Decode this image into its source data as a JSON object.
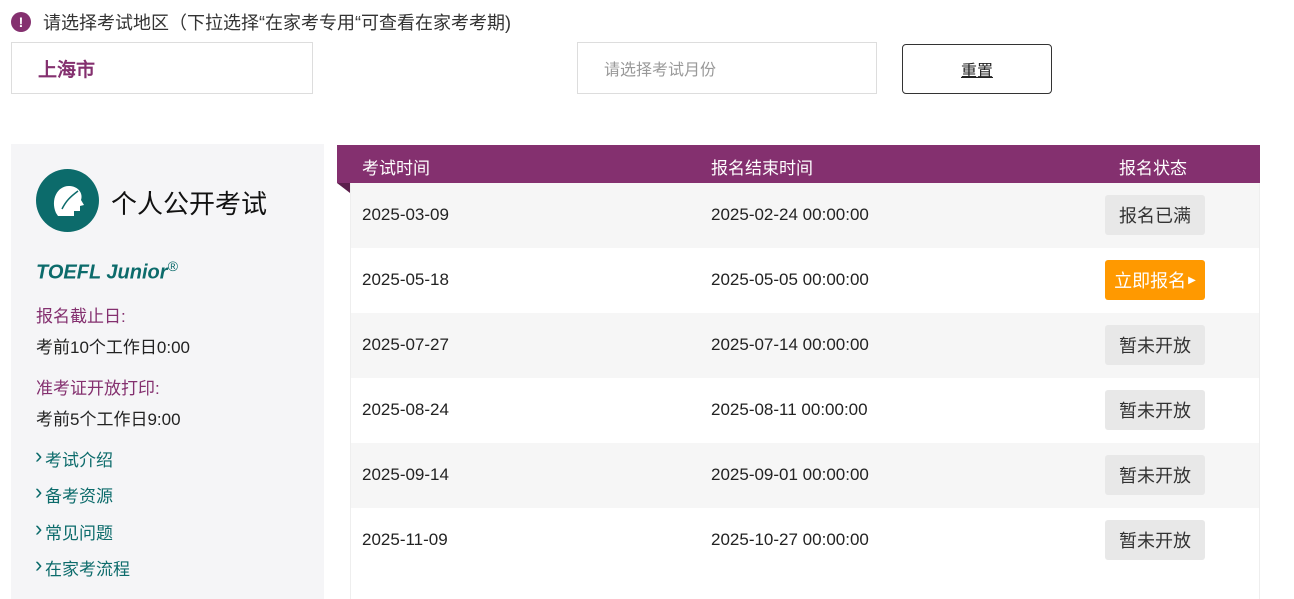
{
  "notice": "请选择考试地区（下拉选择“在家考专用“可查看在家考考期)",
  "filters": {
    "region": "上海市",
    "month_placeholder": "请选择考试月份",
    "reset": "重置"
  },
  "panel": {
    "title": "个人公开考试",
    "brand": "TOEFL Junior",
    "brand_mark": "®",
    "deadline_label": "报名截止日:",
    "deadline_value": "考前10个工作日0:00",
    "admit_label": "准考证开放打印:",
    "admit_value": "考前5个工作日9:00",
    "links": [
      "考试介绍",
      "备考资源",
      "常见问题",
      "在家考流程"
    ]
  },
  "table": {
    "headers": [
      "考试时间",
      "报名结束时间",
      "报名状态"
    ],
    "rows": [
      {
        "date": "2025-03-09",
        "end": "2025-02-24 00:00:00",
        "status": "报名已满",
        "open": false
      },
      {
        "date": "2025-05-18",
        "end": "2025-05-05 00:00:00",
        "status": "立即报名",
        "open": true
      },
      {
        "date": "2025-07-27",
        "end": "2025-07-14 00:00:00",
        "status": "暂未开放",
        "open": false
      },
      {
        "date": "2025-08-24",
        "end": "2025-08-11 00:00:00",
        "status": "暂未开放",
        "open": false
      },
      {
        "date": "2025-09-14",
        "end": "2025-09-01 00:00:00",
        "status": "暂未开放",
        "open": false
      },
      {
        "date": "2025-11-09",
        "end": "2025-10-27 00:00:00",
        "status": "暂未开放",
        "open": false
      }
    ]
  },
  "colors": {
    "brand": "#84306f",
    "teal": "#0c6b6b",
    "accent": "#ff9900"
  }
}
